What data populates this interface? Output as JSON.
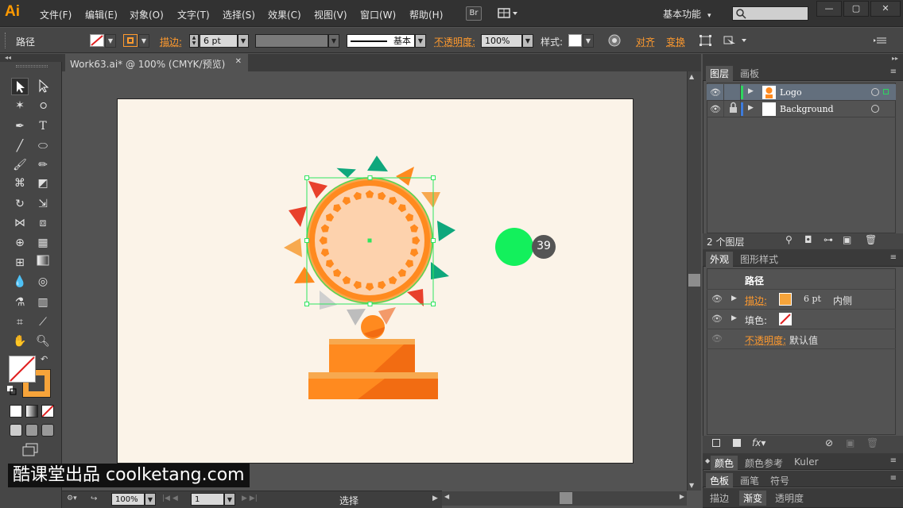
{
  "app": {
    "logo": "Ai",
    "menus": [
      "文件(F)",
      "编辑(E)",
      "对象(O)",
      "文字(T)",
      "选择(S)",
      "效果(C)",
      "视图(V)",
      "窗口(W)",
      "帮助(H)"
    ],
    "bridge_label": "Br",
    "workspace": "基本功能"
  },
  "control_bar": {
    "object_type": "路径",
    "stroke_label": "描边:",
    "stroke_weight": "6 pt",
    "brush_style": "基本",
    "opacity_label": "不透明度:",
    "opacity_value": "100%",
    "style_label": "样式:",
    "align_label": "对齐",
    "transform_label": "变换"
  },
  "document": {
    "tab_title": "Work63.ai* @ 100% (CMYK/预览)",
    "tooltip_number": "39"
  },
  "status_bar": {
    "zoom": "100%",
    "page": "1",
    "tool": "选择"
  },
  "layers_panel": {
    "tabs": [
      "图层",
      "画板"
    ],
    "layers": [
      {
        "name": "Logo",
        "color": "#2fd55f"
      },
      {
        "name": "Background",
        "color": "#3d7bdc"
      }
    ],
    "count": "2 个图层"
  },
  "appearance_panel": {
    "tabs": [
      "外观",
      "图形样式"
    ],
    "title": "路径",
    "stroke_label": "描边:",
    "stroke_weight": "6 pt",
    "stroke_align": "内侧",
    "fill_label": "填色:",
    "opacity_label": "不透明度:",
    "opacity_value": "默认值"
  },
  "color_panels": {
    "row1": [
      "颜色",
      "颜色参考",
      "Kuler"
    ],
    "row2": [
      "色板",
      "画笔",
      "符号"
    ],
    "row3": [
      "描边",
      "渐变",
      "透明度"
    ]
  },
  "watermark": "酷课堂出品 coolketang.com",
  "colors": {
    "accent_orange": "#ff8a1f",
    "teal": "#0fa77c",
    "red": "#e8412c",
    "green_selection": "#2fe55f",
    "bright_green": "#13f05c"
  }
}
